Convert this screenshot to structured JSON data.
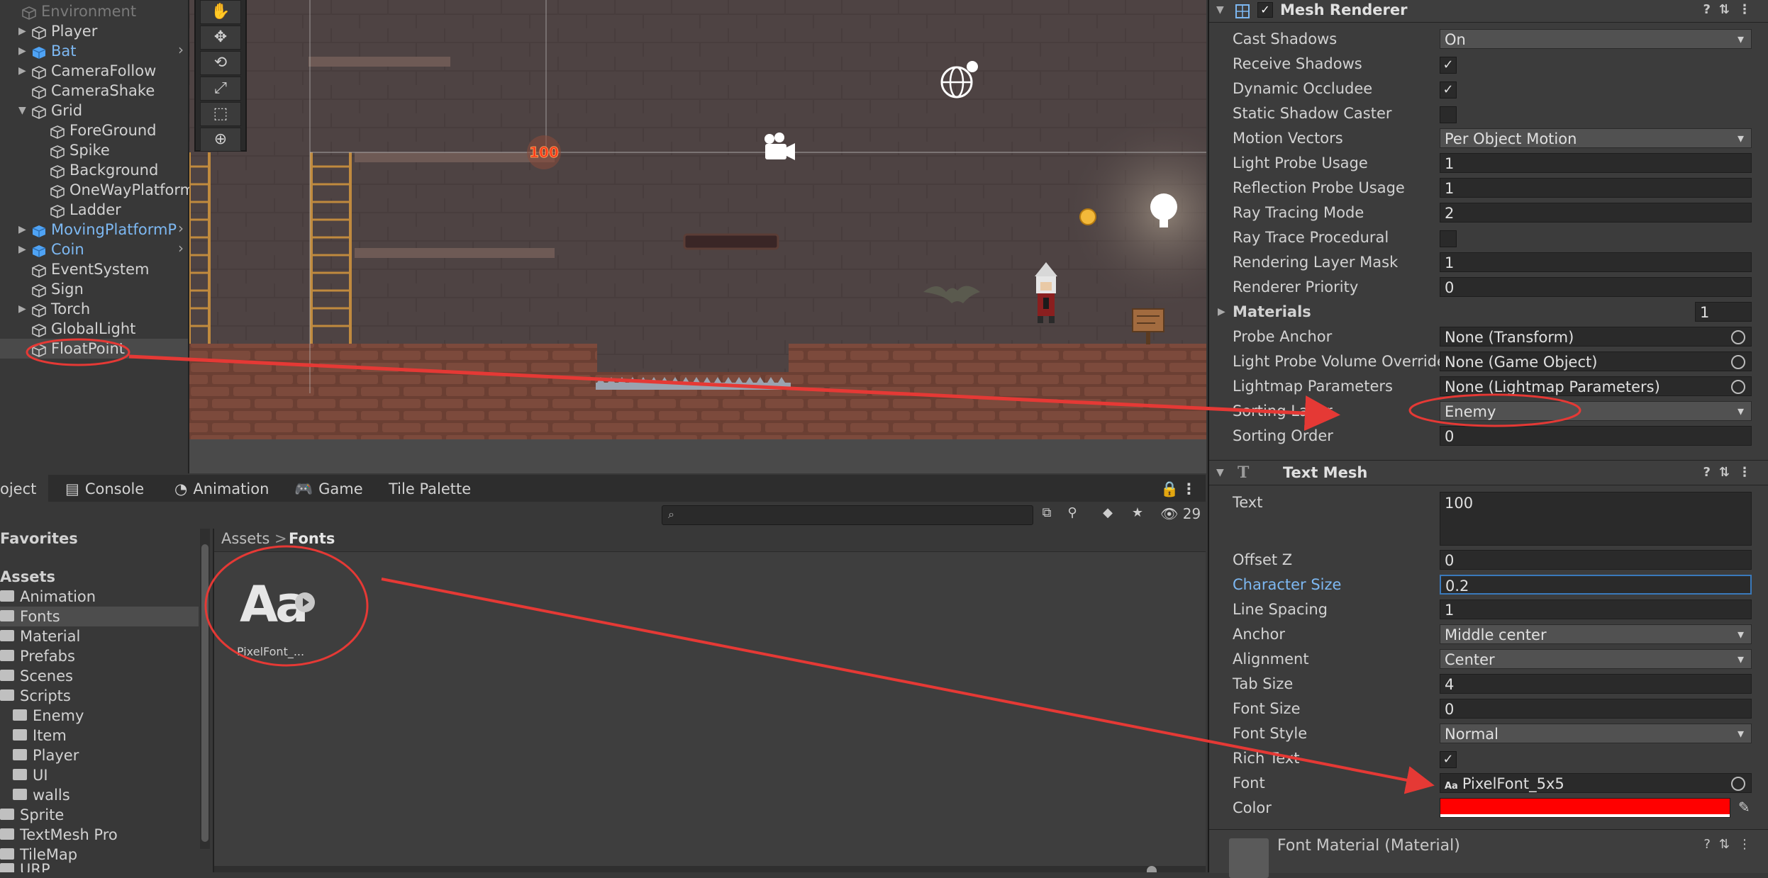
{
  "hierarchy": {
    "items": [
      {
        "label": "Environment"
      },
      {
        "label": "Player"
      },
      {
        "label": "Bat"
      },
      {
        "label": "CameraFollow"
      },
      {
        "label": "CameraShake"
      },
      {
        "label": "Grid"
      },
      {
        "label": "ForeGround"
      },
      {
        "label": "Spike"
      },
      {
        "label": "Background"
      },
      {
        "label": "OneWayPlatform"
      },
      {
        "label": "Ladder"
      },
      {
        "label": "MovingPlatformP"
      },
      {
        "label": "Coin"
      },
      {
        "label": "EventSystem"
      },
      {
        "label": "Sign"
      },
      {
        "label": "Torch"
      },
      {
        "label": "GlobalLight"
      },
      {
        "label": "FloatPoint"
      }
    ]
  },
  "scene": {
    "damage_text": "100",
    "tools": [
      "hand-icon",
      "move-icon",
      "rotate-icon",
      "scale-icon",
      "rect-icon",
      "transform-icon"
    ]
  },
  "bottom_tabs": {
    "project": "oject",
    "console": "Console",
    "animation": "Animation",
    "game": "Game",
    "tile_palette": "Tile Palette"
  },
  "project": {
    "search_placeholder": "",
    "count": "29",
    "favorites": "Favorites",
    "assets": "Assets",
    "tree": [
      "Animation",
      "Fonts",
      "Material",
      "Prefabs",
      "Scenes",
      "Scripts",
      "Enemy",
      "Item",
      "Player",
      "UI",
      "walls",
      "Sprite",
      "TextMesh Pro",
      "TileMap",
      "URP"
    ],
    "breadcrumb_root": "Assets",
    "breadcrumb_sep": ">",
    "breadcrumb_current": "Fonts",
    "asset_icon_text": "Aa",
    "asset_name": "PixelFont_..."
  },
  "inspector": {
    "mesh_renderer": {
      "title": "Mesh Renderer",
      "rows": {
        "cast_shadows": {
          "label": "Cast Shadows",
          "value": "On"
        },
        "receive_shadows": {
          "label": "Receive Shadows",
          "checked": true
        },
        "dynamic_occludee": {
          "label": "Dynamic Occludee",
          "checked": true
        },
        "static_shadow_caster": {
          "label": "Static Shadow Caster",
          "checked": false
        },
        "motion_vectors": {
          "label": "Motion Vectors",
          "value": "Per Object Motion"
        },
        "light_probe_usage": {
          "label": "Light Probe Usage",
          "value": "1"
        },
        "reflection_probe_usage": {
          "label": "Reflection Probe Usage",
          "value": "1"
        },
        "ray_tracing_mode": {
          "label": "Ray Tracing Mode",
          "value": "2"
        },
        "ray_trace_procedural": {
          "label": "Ray Trace Procedural",
          "checked": false
        },
        "rendering_layer_mask": {
          "label": "Rendering Layer Mask",
          "value": "1"
        },
        "renderer_priority": {
          "label": "Renderer Priority",
          "value": "0"
        },
        "materials": {
          "label": "Materials",
          "value": "1"
        },
        "probe_anchor": {
          "label": "Probe Anchor",
          "value": "None (Transform)"
        },
        "light_probe_volume_override": {
          "label": "Light Probe Volume Override",
          "value": "None (Game Object)"
        },
        "lightmap_parameters": {
          "label": "Lightmap Parameters",
          "value": "None (Lightmap Parameters)"
        },
        "sorting_layer": {
          "label": "Sorting Layer",
          "value": "Enemy"
        },
        "sorting_order": {
          "label": "Sorting Order",
          "value": "0"
        }
      }
    },
    "text_mesh": {
      "title": "Text Mesh",
      "rows": {
        "text": {
          "label": "Text",
          "value": "100"
        },
        "offset_z": {
          "label": "Offset Z",
          "value": "0"
        },
        "character_size": {
          "label": "Character Size",
          "value": "0.2"
        },
        "line_spacing": {
          "label": "Line Spacing",
          "value": "1"
        },
        "anchor": {
          "label": "Anchor",
          "value": "Middle center"
        },
        "alignment": {
          "label": "Alignment",
          "value": "Center"
        },
        "tab_size": {
          "label": "Tab Size",
          "value": "4"
        },
        "font_size": {
          "label": "Font Size",
          "value": "0"
        },
        "font_style": {
          "label": "Font Style",
          "value": "Normal"
        },
        "rich_text": {
          "label": "Rich Text",
          "checked": true
        },
        "font": {
          "label": "Font",
          "value": "PixelFont_5x5",
          "icon_text": "Aa"
        },
        "color": {
          "label": "Color",
          "value": "#ff0000"
        }
      }
    },
    "font_material": {
      "title": "Font Material (Material)"
    }
  },
  "colors": {
    "annotation_red": "#e53935",
    "prefab_blue": "#7db8f2",
    "selected_highlight": "#4a4a4a",
    "text_color_swatch": "#ff0000"
  }
}
